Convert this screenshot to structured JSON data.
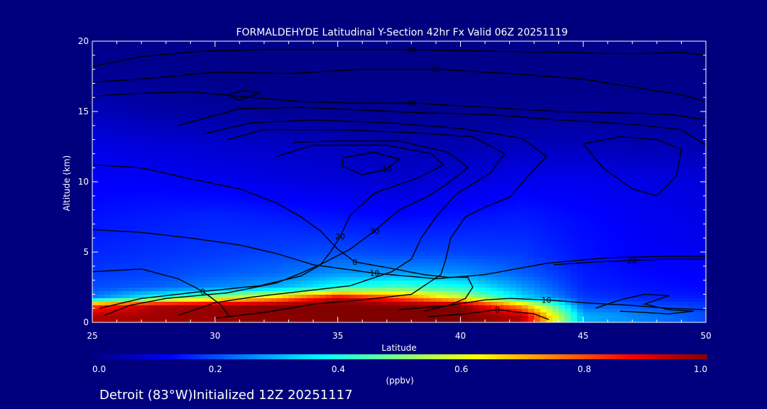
{
  "chart_data": {
    "type": "heatmap",
    "title": "FORMALDEHYDE Latitudinal Y-Section 42hr  Fx Valid 06Z 20251119",
    "xlabel": "Latitude",
    "ylabel": "Altitude (km)",
    "xlim": [
      25,
      50
    ],
    "ylim": [
      0,
      20
    ],
    "xticks": [
      "25",
      "30",
      "35",
      "40",
      "45",
      "50"
    ],
    "yticks": [
      "0",
      "5",
      "10",
      "15",
      "20"
    ],
    "colorbar": {
      "min": 0.0,
      "max": 1.0,
      "ticks": [
        "0.0",
        "0.2",
        "0.4",
        "0.6",
        "0.8",
        "1.0"
      ],
      "units": "(ppbv)",
      "colors": [
        "#00007f",
        "#0000ff",
        "#0080ff",
        "#00ffff",
        "#80ff80",
        "#ffff00",
        "#ff8000",
        "#ff0000",
        "#800000"
      ]
    },
    "field": {
      "x": [
        25,
        27.5,
        30,
        32.5,
        35,
        37.5,
        40,
        42.5,
        45,
        47.5,
        50
      ],
      "rows": [
        {
          "z": 0.5,
          "values": [
            0.95,
            0.97,
            0.98,
            0.99,
            1.0,
            1.0,
            1.0,
            0.95,
            0.3,
            0.25,
            0.2
          ]
        },
        {
          "z": 1.25,
          "values": [
            0.8,
            0.95,
            0.98,
            1.0,
            1.0,
            1.0,
            1.0,
            0.7,
            0.22,
            0.2,
            0.18
          ]
        },
        {
          "z": 1.75,
          "values": [
            0.25,
            0.4,
            0.55,
            0.7,
            0.95,
            0.8,
            0.6,
            0.35,
            0.18,
            0.16,
            0.15
          ]
        },
        {
          "z": 2.5,
          "values": [
            0.2,
            0.22,
            0.26,
            0.3,
            0.4,
            0.45,
            0.4,
            0.28,
            0.16,
            0.14,
            0.13
          ]
        },
        {
          "z": 3.5,
          "values": [
            0.18,
            0.19,
            0.21,
            0.23,
            0.27,
            0.28,
            0.27,
            0.22,
            0.15,
            0.13,
            0.12
          ]
        },
        {
          "z": 5,
          "values": [
            0.16,
            0.17,
            0.18,
            0.19,
            0.2,
            0.19,
            0.19,
            0.18,
            0.14,
            0.12,
            0.11
          ]
        },
        {
          "z": 7.5,
          "values": [
            0.14,
            0.15,
            0.16,
            0.15,
            0.14,
            0.13,
            0.14,
            0.15,
            0.13,
            0.11,
            0.1
          ]
        },
        {
          "z": 10,
          "values": [
            0.12,
            0.12,
            0.11,
            0.1,
            0.09,
            0.08,
            0.09,
            0.11,
            0.11,
            0.1,
            0.09
          ]
        },
        {
          "z": 12.5,
          "values": [
            0.1,
            0.09,
            0.08,
            0.07,
            0.06,
            0.05,
            0.05,
            0.06,
            0.06,
            0.05,
            0.05
          ]
        },
        {
          "z": 15,
          "values": [
            0.06,
            0.04,
            0.03,
            0.02,
            0.02,
            0.02,
            0.02,
            0.02,
            0.02,
            0.02,
            0.02
          ]
        },
        {
          "z": 17.5,
          "values": [
            0.02,
            0.02,
            0.01,
            0.01,
            0.01,
            0.01,
            0.01,
            0.01,
            0.01,
            0.01,
            0.01
          ]
        },
        {
          "z": 20,
          "values": [
            0.01,
            0.01,
            0.01,
            0.01,
            0.01,
            0.01,
            0.01,
            0.01,
            0.01,
            0.01,
            0.01
          ]
        }
      ]
    },
    "contours": [
      {
        "label": "40",
        "points": [
          [
            25,
            18.2
          ],
          [
            27,
            18.9
          ],
          [
            29.5,
            19.3
          ],
          [
            32,
            19.4
          ],
          [
            35,
            19.4
          ],
          [
            38,
            19.4
          ],
          [
            41,
            19.3
          ],
          [
            44,
            19.2
          ],
          [
            47,
            19.1
          ],
          [
            49,
            19.2
          ],
          [
            50,
            19.0
          ]
        ]
      },
      {
        "label": "30",
        "points": [
          [
            25,
            17.1
          ],
          [
            27,
            17.3
          ],
          [
            30,
            17.8
          ],
          [
            33,
            17.7
          ],
          [
            36,
            18.0
          ],
          [
            39,
            18.0
          ],
          [
            42,
            17.7
          ],
          [
            45,
            17.3
          ],
          [
            47.5,
            16.6
          ],
          [
            49,
            16.2
          ],
          [
            50,
            15.7
          ]
        ]
      },
      {
        "label": "40",
        "points": [
          [
            25,
            16.1
          ],
          [
            27,
            16.3
          ],
          [
            29,
            16.4
          ],
          [
            31.5,
            16.0
          ],
          [
            33.5,
            15.7
          ],
          [
            35.5,
            15.6
          ],
          [
            38,
            15.6
          ],
          [
            41,
            15.3
          ],
          [
            44,
            15.0
          ],
          [
            46.5,
            14.9
          ],
          [
            48.5,
            14.8
          ],
          [
            50,
            14.4
          ]
        ]
      },
      {
        "label": "",
        "points": [
          [
            28.5,
            14.0
          ],
          [
            31,
            15.2
          ],
          [
            33.5,
            15.3
          ],
          [
            36,
            15.1
          ],
          [
            38.5,
            14.9
          ],
          [
            41,
            14.8
          ],
          [
            44,
            14.4
          ],
          [
            47,
            14.1
          ],
          [
            49,
            13.7
          ],
          [
            50,
            12.6
          ]
        ]
      },
      {
        "label": "",
        "points": [
          [
            29.5,
            13.4
          ],
          [
            31.5,
            14.2
          ],
          [
            34,
            14.4
          ],
          [
            37,
            14.2
          ],
          [
            40,
            13.8
          ],
          [
            42.5,
            13.1
          ],
          [
            43.5,
            11.8
          ],
          [
            42.8,
            10.5
          ],
          [
            42,
            8.9
          ],
          [
            41,
            8.2
          ],
          [
            40.2,
            7.5
          ],
          [
            39.6,
            6.0
          ],
          [
            39.4,
            4.5
          ],
          [
            39.2,
            3.4
          ],
          [
            38,
            2.0
          ],
          [
            36,
            1.6
          ],
          [
            34,
            1.3
          ],
          [
            32,
            0.7
          ],
          [
            30,
            0.3
          ]
        ]
      },
      {
        "label": "",
        "points": [
          [
            30.5,
            13.0
          ],
          [
            32,
            13.7
          ],
          [
            35,
            13.7
          ],
          [
            38,
            13.5
          ],
          [
            40.5,
            13.2
          ],
          [
            41.8,
            12.0
          ],
          [
            41.2,
            10.6
          ],
          [
            39.8,
            9.1
          ],
          [
            39,
            7.5
          ],
          [
            38.4,
            6.0
          ],
          [
            38.0,
            4.5
          ],
          [
            37.2,
            3.6
          ],
          [
            35.5,
            2.6
          ],
          [
            33.5,
            2.2
          ],
          [
            31.5,
            1.8
          ],
          [
            30,
            1.4
          ],
          [
            28.5,
            0.5
          ]
        ]
      },
      {
        "label": "30",
        "points": [
          [
            33.2,
            12.8
          ],
          [
            35,
            12.9
          ],
          [
            37.5,
            12.9
          ],
          [
            39.5,
            12.1
          ],
          [
            40.3,
            11.0
          ],
          [
            39.5,
            9.9
          ],
          [
            38.6,
            8.9
          ],
          [
            37.5,
            8.0
          ],
          [
            36.5,
            6.5
          ],
          [
            35.5,
            5.2
          ],
          [
            34.5,
            4.3
          ],
          [
            33.5,
            3.5
          ],
          [
            32.5,
            2.8
          ],
          [
            30.5,
            2.1
          ],
          [
            28,
            1.7
          ],
          [
            26.5,
            1.2
          ],
          [
            25.5,
            0.5
          ]
        ]
      },
      {
        "label": "20",
        "points": [
          [
            32.5,
            11.8
          ],
          [
            34,
            12.6
          ],
          [
            37,
            12.6
          ],
          [
            38.8,
            12.0
          ],
          [
            39.3,
            11.2
          ],
          [
            38.3,
            10.3
          ],
          [
            36.5,
            9.2
          ],
          [
            35.5,
            7.6
          ],
          [
            35.1,
            6.1
          ],
          [
            34.7,
            5.0
          ],
          [
            34.3,
            4.1
          ],
          [
            33.5,
            3.3
          ],
          [
            31.8,
            2.6
          ],
          [
            29.5,
            2.2
          ],
          [
            27,
            1.7
          ],
          [
            25.3,
            1.0
          ]
        ]
      },
      {
        "label": "10",
        "points": [
          [
            35.2,
            11.7
          ],
          [
            36.5,
            12.1
          ],
          [
            37.5,
            11.6
          ],
          [
            37.0,
            10.9
          ],
          [
            36.0,
            10.5
          ],
          [
            35.2,
            11.1
          ],
          [
            35.2,
            11.7
          ]
        ]
      },
      {
        "label": "0",
        "points": [
          [
            25,
            11.2
          ],
          [
            27,
            11.0
          ],
          [
            29,
            10.2
          ],
          [
            31,
            9.5
          ],
          [
            32.5,
            8.5
          ],
          [
            33.5,
            7.5
          ],
          [
            34.3,
            6.5
          ],
          [
            35.0,
            5.2
          ],
          [
            35.7,
            4.3
          ],
          [
            37,
            3.9
          ],
          [
            38.5,
            3.4
          ],
          [
            39.5,
            3.2
          ],
          [
            40.3,
            3.2
          ],
          [
            40.5,
            2.5
          ],
          [
            40.2,
            1.7
          ],
          [
            39.5,
            1.2
          ],
          [
            38.5,
            0.8
          ]
        ]
      },
      {
        "label": "10",
        "points": [
          [
            25,
            6.6
          ],
          [
            27,
            6.4
          ],
          [
            29,
            6.0
          ],
          [
            31,
            5.5
          ],
          [
            32.5,
            4.9
          ],
          [
            34,
            4.1
          ],
          [
            36.5,
            3.5
          ],
          [
            39,
            3.1
          ],
          [
            41,
            3.4
          ],
          [
            43.5,
            4.2
          ],
          [
            46,
            4.6
          ],
          [
            48.5,
            4.7
          ],
          [
            50,
            4.7
          ]
        ]
      },
      {
        "label": "0",
        "points": [
          [
            25,
            3.6
          ],
          [
            27,
            3.8
          ],
          [
            28.5,
            3.1
          ],
          [
            29.5,
            2.2
          ],
          [
            30.2,
            1.3
          ],
          [
            30.6,
            0.4
          ]
        ]
      },
      {
        "label": "10",
        "points": [
          [
            37.5,
            0.9
          ],
          [
            39.5,
            1.2
          ],
          [
            41,
            1.6
          ],
          [
            42,
            1.7
          ],
          [
            43.5,
            1.6
          ],
          [
            45,
            1.4
          ],
          [
            47,
            1.2
          ],
          [
            48.5,
            1.0
          ],
          [
            50,
            0.9
          ]
        ]
      },
      {
        "label": "0",
        "points": [
          [
            38.7,
            0.4
          ],
          [
            40.2,
            0.6
          ],
          [
            41.5,
            0.9
          ],
          [
            43,
            0.6
          ],
          [
            43.6,
            0.2
          ]
        ]
      },
      {
        "label": "20",
        "points": [
          [
            43.8,
            4.1
          ],
          [
            45.5,
            4.3
          ],
          [
            47,
            4.4
          ],
          [
            48.5,
            4.5
          ],
          [
            50,
            4.5
          ]
        ]
      },
      {
        "label": "",
        "points": [
          [
            45,
            12.7
          ],
          [
            46.5,
            13.2
          ],
          [
            48,
            13.0
          ],
          [
            49,
            12.3
          ],
          [
            48.8,
            10.4
          ],
          [
            48,
            9.0
          ],
          [
            47,
            9.5
          ],
          [
            45.8,
            11.0
          ],
          [
            45,
            12.7
          ]
        ]
      },
      {
        "label": "",
        "points": [
          [
            45.5,
            1.0
          ],
          [
            46.5,
            1.6
          ],
          [
            47.5,
            2.0
          ],
          [
            48.5,
            1.9
          ],
          [
            47.5,
            1.3
          ],
          [
            48.5,
            0.9
          ],
          [
            49.5,
            0.8
          ],
          [
            48.5,
            0.6
          ],
          [
            46.5,
            0.8
          ]
        ]
      },
      {
        "label": "",
        "points": [
          [
            30.5,
            16.2
          ],
          [
            31.2,
            16.5
          ],
          [
            31.8,
            16.3
          ],
          [
            31.0,
            15.8
          ],
          [
            30.5,
            16.2
          ]
        ]
      }
    ],
    "footer": "Detroit (83°W)Initialized 12Z 20251117"
  }
}
